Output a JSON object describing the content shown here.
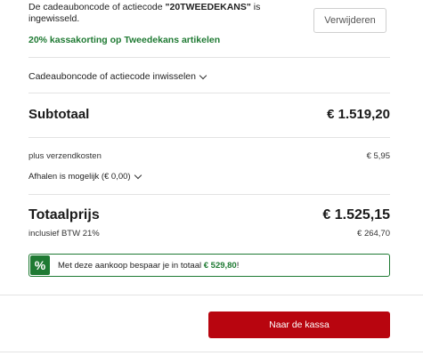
{
  "coupon": {
    "message_prefix": "De cadeauboncode of actiecode ",
    "code": "\"20TWEEDEKANS\"",
    "message_suffix": " is ingewisseld.",
    "discount_text": "20% kassakorting op Tweedekans artikelen",
    "remove_label": "Verwijderen"
  },
  "redeem": {
    "label": "Cadeauboncode of actiecode inwisselen"
  },
  "subtotal": {
    "label": "Subtotaal",
    "value": "€ 1.519,20"
  },
  "shipping": {
    "label": "plus verzendkosten",
    "value": "€ 5,95",
    "pickup_label": "Afhalen is mogelijk (€ 0,00)"
  },
  "total": {
    "label": "Totaalprijs",
    "value": "€ 1.525,15",
    "vat_label": "inclusief BTW 21%",
    "vat_value": "€ 264,70"
  },
  "savings": {
    "badge": "%",
    "text_prefix": "Met deze aankoop bespaar je in totaal ",
    "amount": "€ 529,80",
    "text_suffix": "!"
  },
  "checkout": {
    "label": "Naar de kassa"
  },
  "colors": {
    "accent_green": "#1f7a33",
    "checkout_red": "#b8050f"
  },
  "icons": {
    "chevron": "chevron-down-icon",
    "percent": "percent-icon"
  }
}
